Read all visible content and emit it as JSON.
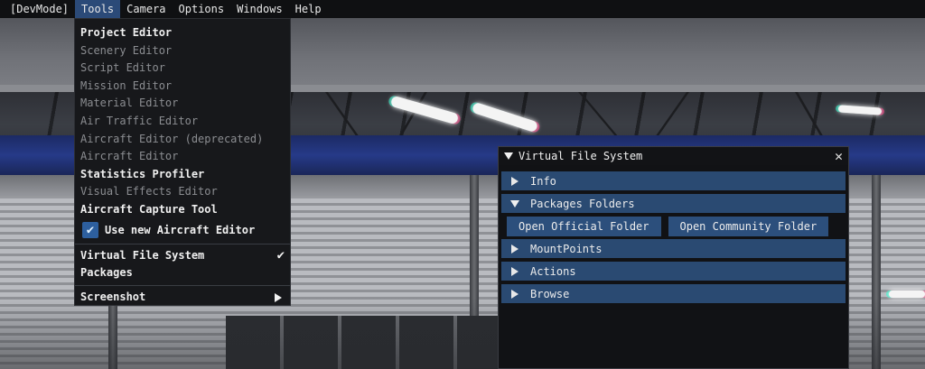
{
  "menubar": {
    "items": [
      {
        "label": "[DevMode]"
      },
      {
        "label": "Tools"
      },
      {
        "label": "Camera"
      },
      {
        "label": "Options"
      },
      {
        "label": "Windows"
      },
      {
        "label": "Help"
      }
    ],
    "active": "Tools"
  },
  "tools_menu": {
    "items": [
      {
        "label": "Project Editor",
        "enabled": true
      },
      {
        "label": "Scenery Editor",
        "enabled": false
      },
      {
        "label": "Script Editor",
        "enabled": false
      },
      {
        "label": "Mission Editor",
        "enabled": false
      },
      {
        "label": "Material Editor",
        "enabled": false
      },
      {
        "label": "Air Traffic Editor",
        "enabled": false
      },
      {
        "label": "Aircraft Editor (deprecated)",
        "enabled": false
      },
      {
        "label": "Aircraft Editor",
        "enabled": false
      },
      {
        "label": "Statistics Profiler",
        "enabled": true
      },
      {
        "label": "Visual Effects Editor",
        "enabled": false
      },
      {
        "label": "Aircraft Capture Tool",
        "enabled": true
      }
    ],
    "use_new_aircraft_editor": {
      "label": "Use new Aircraft Editor",
      "checked": true
    },
    "virtual_file_system": {
      "label": "Virtual File System",
      "checked": true
    },
    "packages": {
      "label": "Packages"
    },
    "screenshot": {
      "label": "Screenshot",
      "has_submenu": true
    }
  },
  "vfs_window": {
    "title": "Virtual File System",
    "sections": {
      "info": {
        "label": "Info",
        "expanded": false
      },
      "packages_folders": {
        "label": "Packages Folders",
        "expanded": true
      },
      "mountpoints": {
        "label": "MountPoints",
        "expanded": false
      },
      "actions": {
        "label": "Actions",
        "expanded": false
      },
      "browse": {
        "label": "Browse",
        "expanded": false
      }
    },
    "buttons": {
      "open_official": "Open Official Folder",
      "open_community": "Open Community Folder"
    }
  },
  "icons": {
    "check": "check-icon",
    "close": "close-icon",
    "submenu": "chevron-right-icon",
    "collapse": "triangle-down-icon",
    "expand": "triangle-right-icon"
  },
  "colors": {
    "accent": "#2b4a78",
    "section_header": "#2a4a72",
    "button": "#2c4f7c",
    "checkbox": "#2d5f9e",
    "menu_bg": "#17181b"
  }
}
